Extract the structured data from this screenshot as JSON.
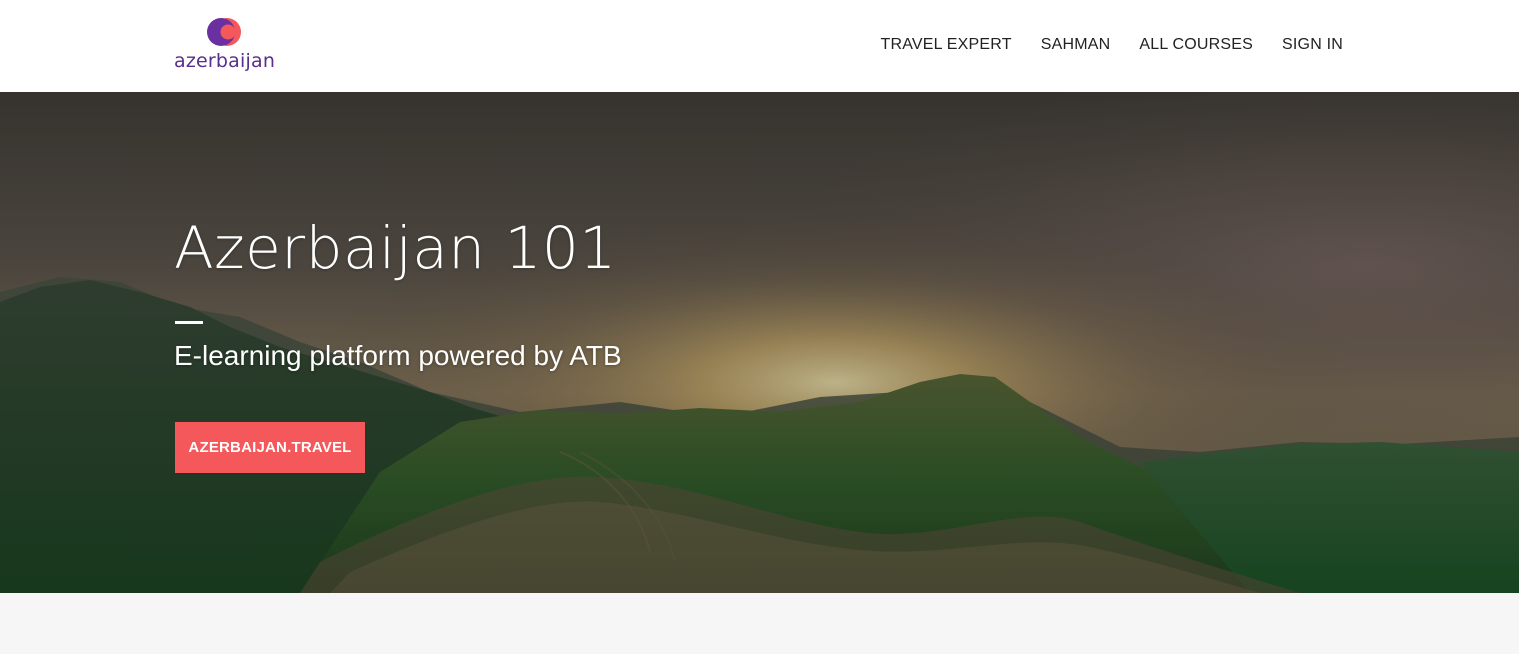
{
  "header": {
    "logo": {
      "text": "azerbaijan",
      "icon": "brand-logo-icon",
      "colors": {
        "purple": "#5b2d8e",
        "coral": "#f4585a"
      }
    },
    "nav": [
      {
        "label": "TRAVEL EXPERT"
      },
      {
        "label": "SAHMAN"
      },
      {
        "label": "ALL COURSES"
      },
      {
        "label": "SIGN IN"
      }
    ]
  },
  "hero": {
    "title": "Azerbaijan 101",
    "subtitle": "E-learning platform powered by ATB",
    "cta_label": "AZERBAIJAN.TRAVEL",
    "cta_color": "#f4585a",
    "background": "mountain-landscape-sunset-image"
  }
}
